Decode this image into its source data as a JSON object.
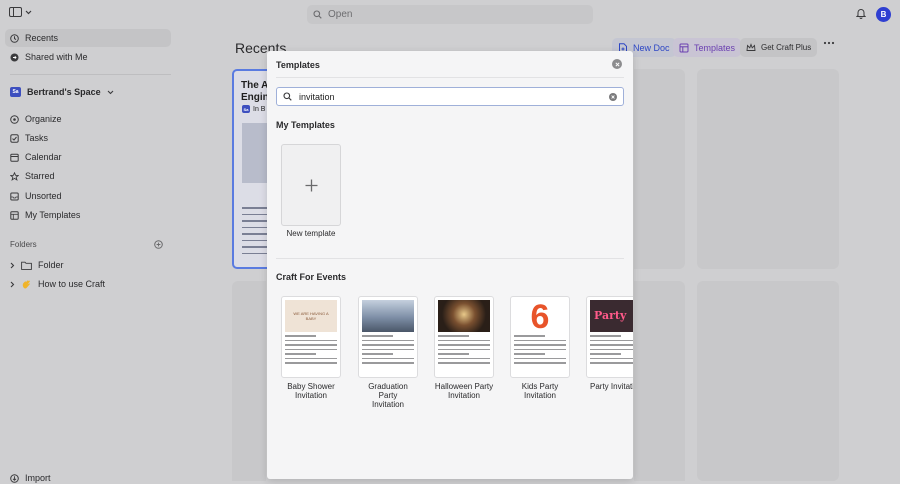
{
  "topbar": {
    "search_placeholder": "Open",
    "avatar_initial": "B"
  },
  "sidebar": {
    "top_items": [
      {
        "label": "Recents"
      },
      {
        "label": "Shared with Me"
      }
    ],
    "space": {
      "badge": "Sa",
      "label": "Bertrand's Space"
    },
    "nav_items": [
      {
        "label": "Organize"
      },
      {
        "label": "Tasks"
      },
      {
        "label": "Calendar"
      },
      {
        "label": "Starred"
      },
      {
        "label": "Unsorted"
      },
      {
        "label": "My Templates"
      }
    ],
    "folders_label": "Folders",
    "tree": [
      {
        "label": "Folder",
        "icon": "folder-icon"
      },
      {
        "label": "How to use Craft",
        "icon": "wave-hand-icon"
      }
    ],
    "import_label": "Import"
  },
  "main": {
    "heading": "Recents",
    "new_doc_label": "New Doc",
    "templates_label": "Templates",
    "get_plus_label": "Get Craft Plus",
    "doc_card": {
      "title_line1": "The Ar",
      "title_line2": "Engine",
      "meta": "In B",
      "badge": "Sa"
    }
  },
  "modal": {
    "title": "Templates",
    "search_value": "invitation",
    "my_templates_heading": "My Templates",
    "new_template_label": "New template",
    "events_heading": "Craft For Events",
    "templates": [
      {
        "label": "Baby Shower\nInvitation",
        "thumb_color": "#e9d5c2",
        "thumb_text": "WE ARE HAVING A BABY"
      },
      {
        "label": "Graduation Party\nInvitation",
        "thumb_color": "#7d8ea6",
        "thumb_text": ""
      },
      {
        "label": "Halloween Party\nInvitation",
        "thumb_color": "#2a1f18",
        "thumb_text": ""
      },
      {
        "label": "Kids Party\nInvitation",
        "thumb_color": "#ffffff",
        "thumb_text": "6"
      },
      {
        "label": "Party Invitation",
        "thumb_color": "#3a2a30",
        "thumb_text": "Party"
      }
    ]
  }
}
